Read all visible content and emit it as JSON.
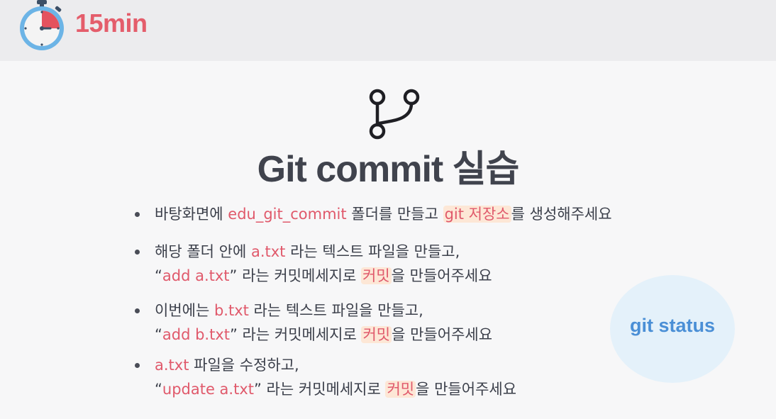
{
  "timer": {
    "label": "15min",
    "icon": "stopwatch-icon"
  },
  "slide": {
    "icon": "git-branch-icon",
    "title": "Git commit 실습",
    "bullets": [
      {
        "lines": [
          [
            {
              "t": "바탕화면에 "
            },
            {
              "t": "edu_git_commit",
              "c": "pink"
            },
            {
              "t": " 폴더를 만들고 "
            },
            {
              "t": "git 저장소",
              "c": "pink",
              "hl": true
            },
            {
              "t": "를 생성해주세요"
            }
          ]
        ]
      },
      {
        "lines": [
          [
            {
              "t": "해당 폴더 안에 "
            },
            {
              "t": "a.txt",
              "c": "pink"
            },
            {
              "t": " 라는 텍스트 파일을 만들고,"
            }
          ],
          [
            {
              "t": "“"
            },
            {
              "t": "add a.txt",
              "c": "pink"
            },
            {
              "t": "” 라는 커밋메세지로 "
            },
            {
              "t": "커밋",
              "c": "pink",
              "hl": true
            },
            {
              "t": "을 만들어주세요"
            }
          ]
        ]
      },
      {
        "lines": [
          [
            {
              "t": "이번에는 "
            },
            {
              "t": "b.txt",
              "c": "pink"
            },
            {
              "t": " 라는 텍스트 파일을 만들고,"
            }
          ],
          [
            {
              "t": "“"
            },
            {
              "t": "add b.txt",
              "c": "pink"
            },
            {
              "t": "” 라는 커밋메세지로 "
            },
            {
              "t": "커밋",
              "c": "pink",
              "hl": true
            },
            {
              "t": "을 만들어주세요"
            }
          ]
        ]
      },
      {
        "lines": [
          [
            {
              "t": "a.txt",
              "c": "pink"
            },
            {
              "t": " 파일을 수정하고,"
            }
          ],
          [
            {
              "t": "“"
            },
            {
              "t": "update a.txt",
              "c": "pink"
            },
            {
              "t": "” 라는 커밋메세지로 "
            },
            {
              "t": "커밋",
              "c": "pink",
              "hl": true
            },
            {
              "t": "을 만들어주세요"
            }
          ]
        ]
      }
    ]
  },
  "hint_badge": {
    "label": "git status"
  },
  "colors": {
    "accent_pink": "#e0596b",
    "highlight": "#fde7d6",
    "badge_text": "#4a8fd6",
    "badge_bg": "#e4f1fa"
  }
}
